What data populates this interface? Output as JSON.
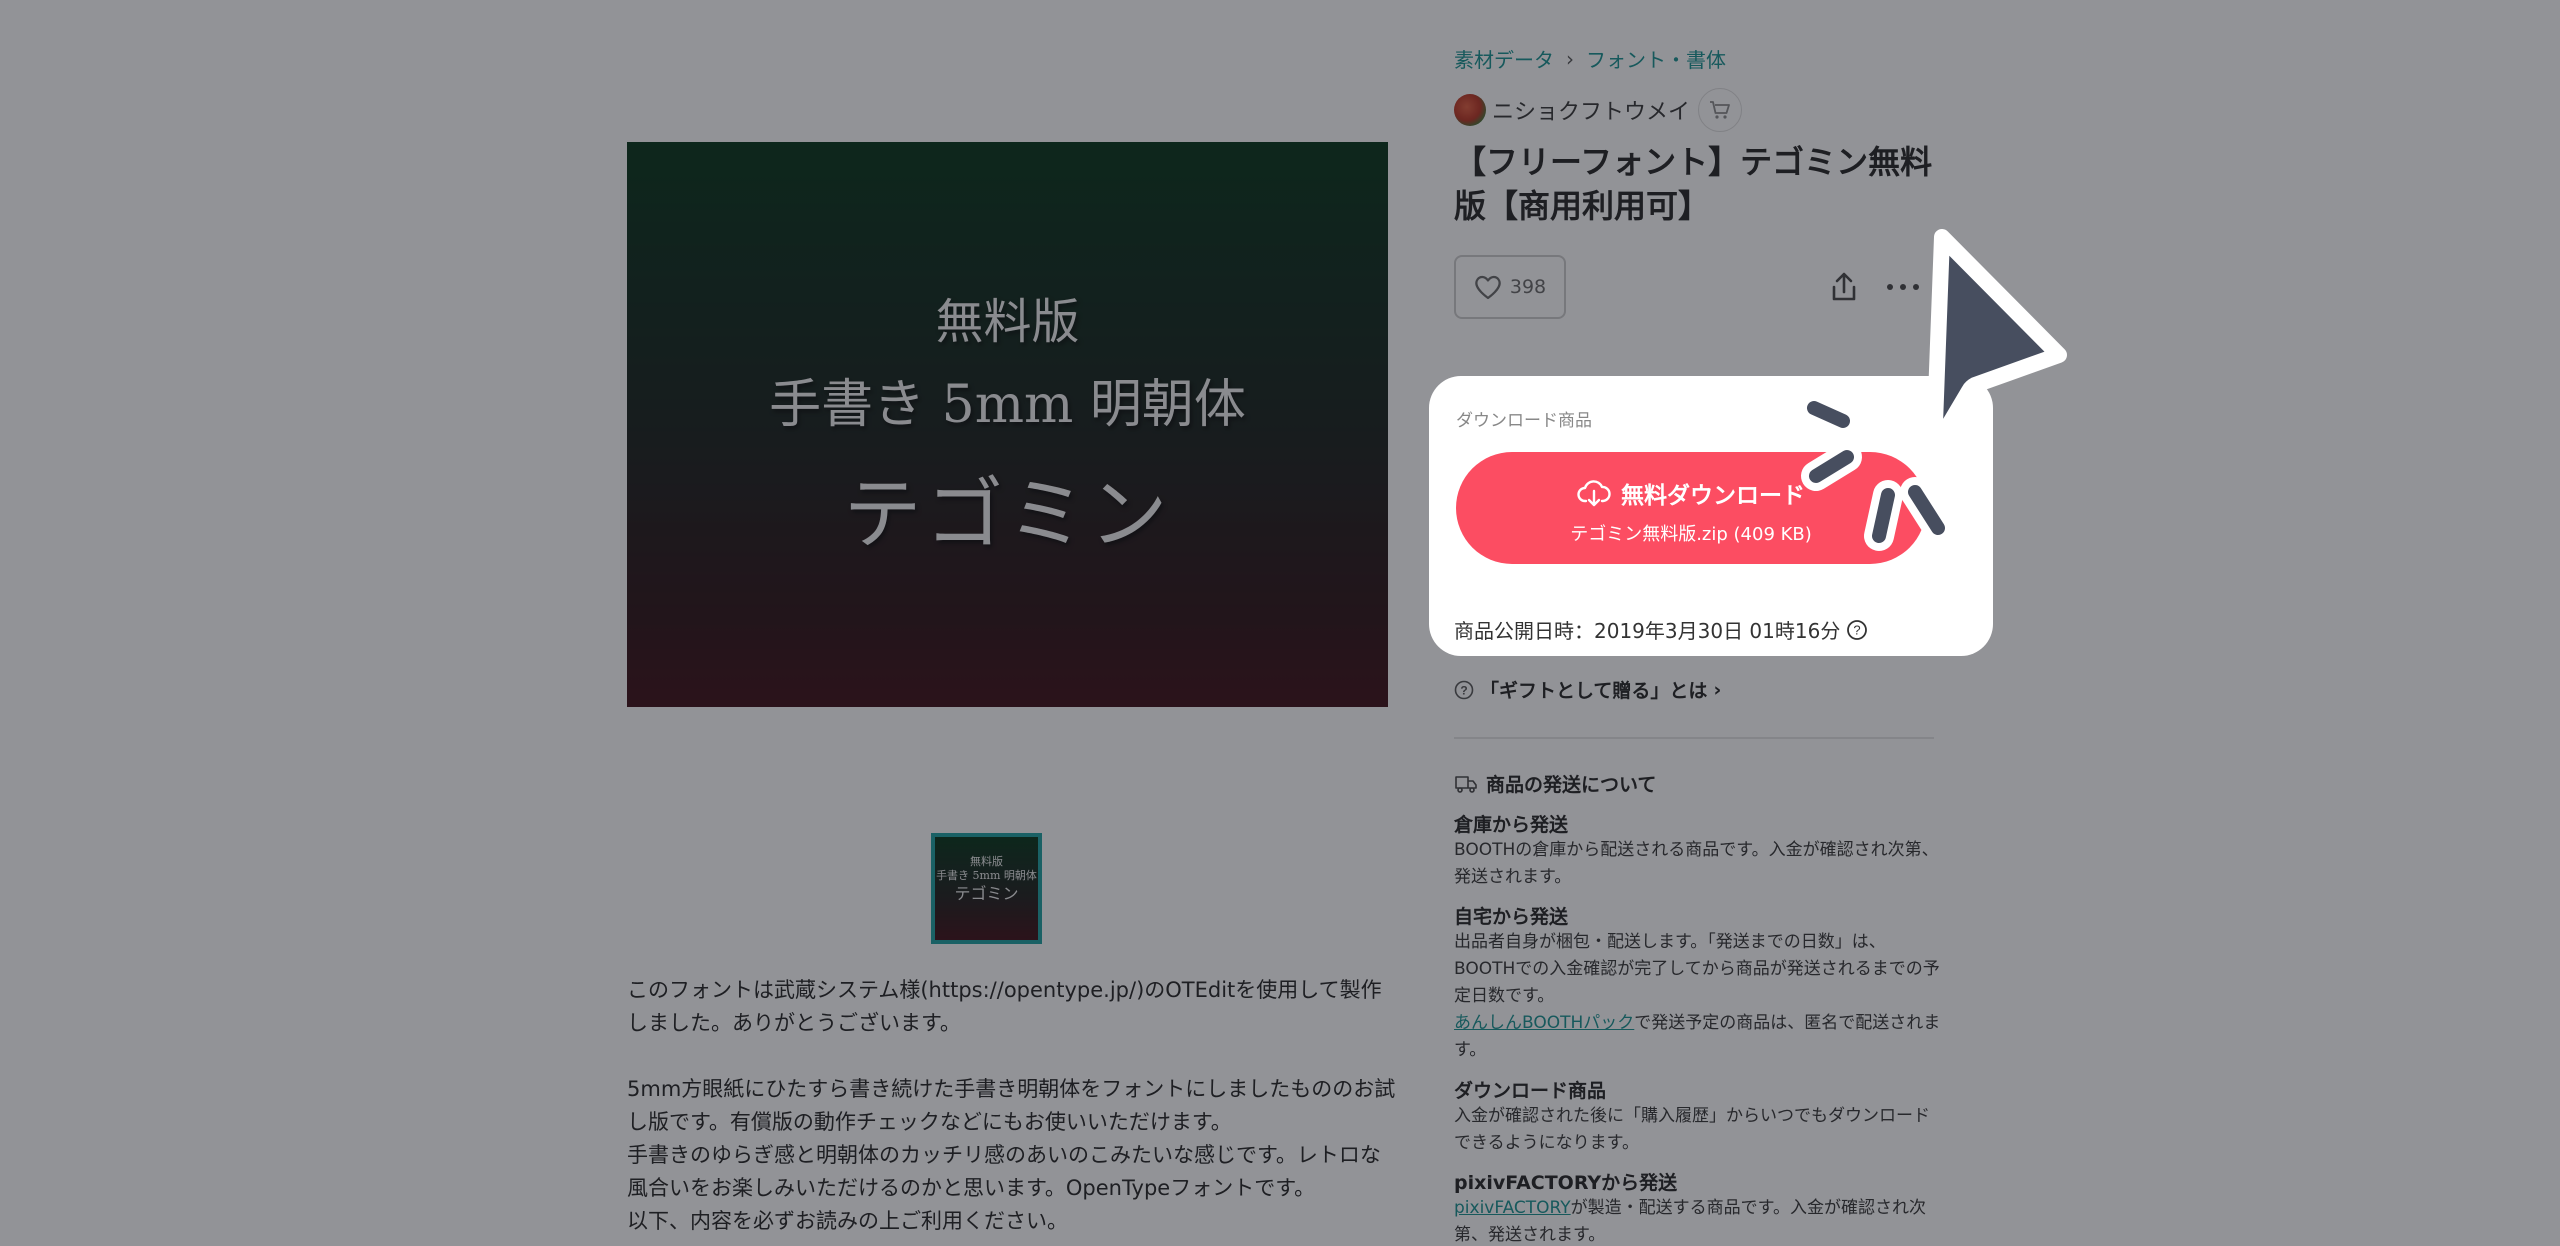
{
  "main_image": {
    "line1": "無料版",
    "line2": "手書き 5mm 明朝体",
    "line3": "テゴミン"
  },
  "thumbnail": {
    "line1": "無料版",
    "line2": "手書き 5mm 明朝体",
    "line3": "テゴミン"
  },
  "description": {
    "para1": "このフォントは武蔵システム様(https://opentype.jp/)のOTEditを使用して製作しました。ありがとうございます。",
    "para2": "5mm方眼紙にひたすら書き続けた手書き明朝体をフォントにしましたもののお試し版です。有償版の動作チェックなどにもお使いいただけます。",
    "para3": "手書きのゆらぎ感と明朝体のカッチリ感のあいのこみたいな感じです。レトロな風合いをお楽しみいただけるのかと思います。OpenTypeフォントです。",
    "para4": "以下、内容を必ずお読みの上ご利用ください。"
  },
  "breadcrumb": {
    "items": [
      "素材データ",
      "フォント・書体"
    ],
    "separator": "›"
  },
  "shop": {
    "name": "ニショクフトウメイ"
  },
  "product": {
    "title": "【フリーフォント】テゴミン無料版【商用利用可】",
    "likes": "398"
  },
  "download_card": {
    "label": "ダウンロード商品",
    "button_label": "無料ダウンロード",
    "file": "テゴミン無料版.zip (409 KB)",
    "date_label": "商品公開日時：2019年3月30日 01時16分"
  },
  "gift": {
    "label": "「ギフトとして贈る」とは"
  },
  "shipping": {
    "heading": "商品の発送について",
    "sections": [
      {
        "title": "倉庫から発送",
        "body": "BOOTHの倉庫から配送される商品です。入金が確認され次第、発送されます。"
      },
      {
        "title": "自宅から発送",
        "body": "出品者自身が梱包・配送します。「発送までの日数」は、BOOTHでの入金確認が完了してから商品が発送されるまでの予定日数です。"
      },
      {
        "link": "あんしんBOOTHパック",
        "body": "で発送予定の商品は、匿名で配送されます。"
      },
      {
        "title": "ダウンロード商品",
        "body": "入金が確認された後に「購入履歴」からいつでもダウンロードできるようになります。"
      },
      {
        "title": "pixivFACTORYから発送",
        "link": "pixivFACTORY",
        "body": "が製造・配送する商品です。入金が確認され次第、発送されます。"
      }
    ]
  },
  "colors": {
    "accent": "#fc4d62",
    "link": "#14908f",
    "overlay": "#1c1e26",
    "cursor": "#474e5f"
  }
}
